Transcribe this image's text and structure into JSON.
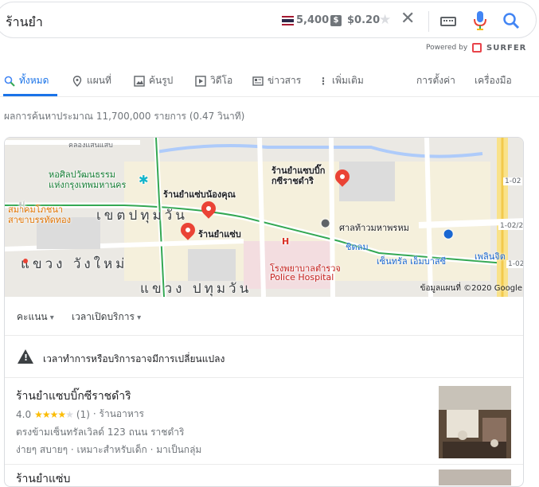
{
  "search": {
    "query": "ร้านยำ"
  },
  "surfer": {
    "country_volume": "5,400",
    "cpc": "$0.20",
    "powered_by": "Powered by",
    "brand": "SURFER"
  },
  "tabs": [
    {
      "label": "ทั้งหมด",
      "icon": "search-icon",
      "active": true
    },
    {
      "label": "แผนที่",
      "icon": "map-pin-icon"
    },
    {
      "label": "ค้นรูป",
      "icon": "image-icon"
    },
    {
      "label": "วิดีโอ",
      "icon": "video-icon"
    },
    {
      "label": "ข่าวสาร",
      "icon": "news-icon"
    },
    {
      "label": "เพิ่มเติม",
      "icon": "more-icon"
    }
  ],
  "tabs_right": {
    "settings": "การตั้งค่า",
    "tools": "เครื่องมือ"
  },
  "stats": "ผลการค้นหาประมาณ 11,700,000 รายการ (0.47 วินาที)",
  "map": {
    "labels": {
      "museum": "หอศิลปวัฒนธรรม\nแห่งกรุงเทพมหานคร",
      "pratunam_pier": "สมาคมโภชนา\nสาขาบรรทัดทอง",
      "district_pathumwan": "เขตปทุมวัน",
      "wang_mai": "แขวง วังใหม่",
      "khwaeng_pathumwan": "แขวง ปทุมวัน",
      "shop1": "ร้านยำแซ่บน้องคุณ",
      "shop2": "ร้านยำแซ่บ",
      "shop3": "ร้านยำแซบบิ๊ก\nกซีราชดำริ",
      "shrine": "ศาลท้าวมหาพรหม",
      "hospital": "โรงพยาบาลตำรวจ",
      "hospital_en": "Police Hospital",
      "chidlom": "ชิดลม",
      "central": "เซ็นทรัล เอ็มบาสซี",
      "ploenchit": "เพลินจิต",
      "road1": "1-02",
      "road2": "1-02/2",
      "road3": "1-02",
      "top_road": "คลองแสนแสบ"
    },
    "copyright": "ข้อมูลแผนที่ ©2020 Google"
  },
  "filters": [
    "คะแนน",
    "เวลาเปิดบริการ"
  ],
  "warning": "เวลาทำการหรือบริการอาจมีการเปลี่ยนแปลง",
  "listing": {
    "title": "ร้านยำแซบบิ๊กซีราชดำริ",
    "rating": "4.0",
    "stars": 4,
    "reviews": "(1)",
    "category": "· ร้านอาหาร",
    "address": "ตรงข้ามเซ็นทรัลเวิลด์ 123 ถนน ราชดำริ",
    "tags": "ง่ายๆ สบายๆ · เหมาะสำหรับเด็ก · มาเป็นกลุ่ม"
  },
  "next_listing_title": "ร้านยำแซ่บ",
  "colors": {
    "accent": "#1a73e8",
    "star": "#fbbc04",
    "pin": "#ea4335"
  }
}
